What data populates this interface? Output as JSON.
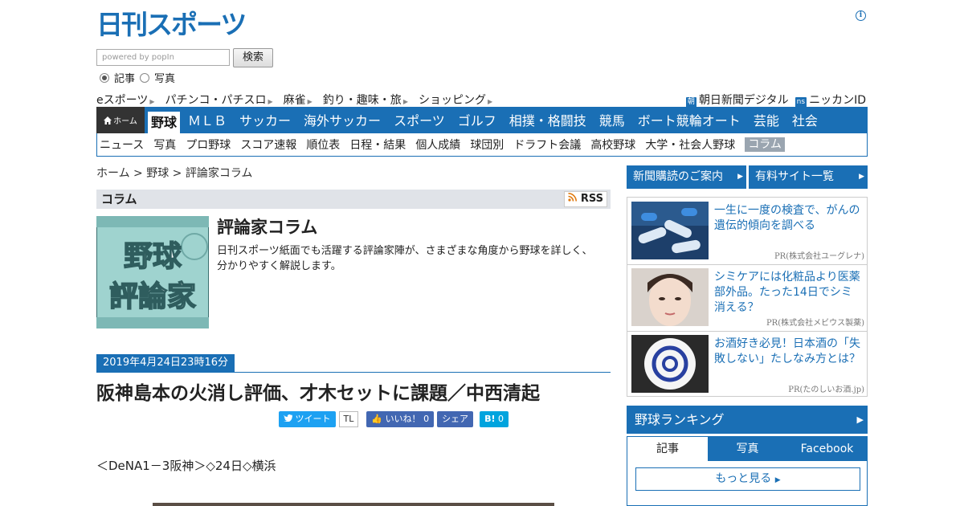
{
  "header": {
    "logo_text": "日刊スポーツ",
    "search_placeholder": "powered by popIn",
    "search_button": "検索",
    "radio_article": "記事",
    "radio_photo": "写真"
  },
  "subnav": [
    "eスポーツ",
    "パチンコ・パチスロ",
    "麻雀",
    "釣り・趣味・旅",
    "ショッピング"
  ],
  "subnav_arrow": "▶",
  "right_links": [
    {
      "badge": "朝",
      "label": "朝日新聞デジタル"
    },
    {
      "badge": "ns",
      "label": "ニッカンID"
    }
  ],
  "mainnav": {
    "home": "ホーム",
    "items": [
      "野球",
      "ＭＬＢ",
      "サッカー",
      "海外サッカー",
      "スポーツ",
      "ゴルフ",
      "相撲・格闘技",
      "競馬",
      "ボート競輪オート",
      "芸能",
      "社会"
    ],
    "active_index": 0
  },
  "secnav": {
    "items": [
      "ニュース",
      "写真",
      "プロ野球",
      "スコア速報",
      "順位表",
      "日程・結果",
      "個人成績",
      "球団別",
      "ドラフト会議",
      "高校野球",
      "大学・社会人野球",
      "コラム"
    ],
    "active_index": 11
  },
  "breadcrumb": "ホーム > 野球 > 評論家コラム",
  "column": {
    "section": "コラム",
    "rss": "RSS",
    "thumb_text1": "野球",
    "thumb_text2": "評論家",
    "title": "評論家コラム",
    "description": "日刊スポーツ紙面でも活躍する評論家陣が、さまざまな角度から野球を詳しく、分かりやすく解説します。"
  },
  "article": {
    "date": "2019年4月24日23時16分",
    "headline": "阪神島本の火消し評価、才木セットに課題／中西清起",
    "lead": "＜DeNA1－3阪神＞◇24日◇横浜"
  },
  "social": {
    "tweet": "ツイート",
    "tl": "TL",
    "like": "いいね！",
    "like_count": "0",
    "share": "シェア",
    "hatena": "B!",
    "hatena_count": "0"
  },
  "sidebar": {
    "btn_subscribe": "新聞購読のご案内",
    "btn_paid": "有料サイト一覧",
    "ads": [
      {
        "text": "一生に一度の検査で、がんの遺伝的傾向を調べる",
        "pr": "PR(株式会社ユーグレナ)"
      },
      {
        "text": "シミケアには化粧品より医薬部外品。たった14日でシミ消える？",
        "pr": "PR(株式会社メビウス製薬)"
      },
      {
        "text": "お酒好き必見！日本酒の「失敗しない」たしなみ方とは？",
        "pr": "PR(たのしいお酒.jp)"
      }
    ],
    "ranking_title": "野球ランキング",
    "tabs": [
      "記事",
      "写真",
      "Facebook"
    ],
    "more": "もっと見る"
  },
  "colors": {
    "brand_blue": "#1a6fb5",
    "home_dark": "#333333"
  }
}
